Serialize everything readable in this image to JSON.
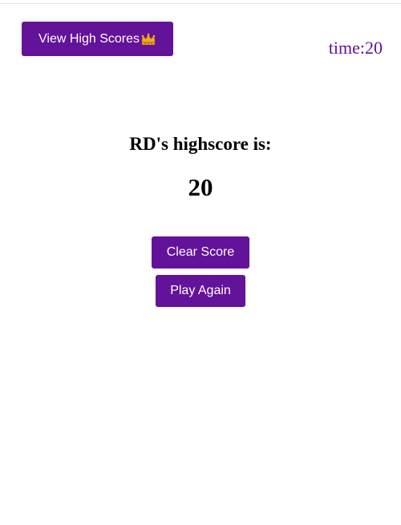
{
  "header": {
    "high_scores_label": "View High Scores",
    "crown_icon": "crown-icon",
    "timer_text": "time:20"
  },
  "main": {
    "headline": "RD's highscore is:",
    "score": "20",
    "clear_label": "Clear Score",
    "play_again_label": "Play Again"
  },
  "colors": {
    "accent": "#63129a",
    "button_text": "#ffffff",
    "crown_gold": "#f2b01e"
  }
}
